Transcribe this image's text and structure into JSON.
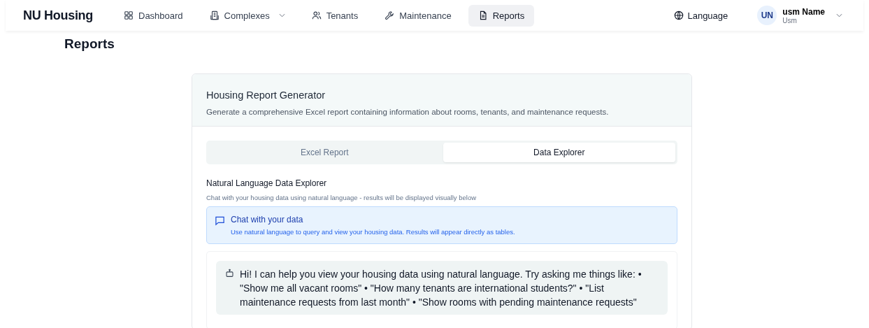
{
  "brand": "NU Housing",
  "nav": [
    {
      "label": "Dashboard",
      "dropdown": false,
      "selected": false
    },
    {
      "label": "Complexes",
      "dropdown": true,
      "selected": false
    },
    {
      "label": "Tenants",
      "dropdown": false,
      "selected": false
    },
    {
      "label": "Maintenance",
      "dropdown": false,
      "selected": false
    },
    {
      "label": "Reports",
      "dropdown": false,
      "selected": true
    }
  ],
  "language": "Language",
  "user": {
    "initials": "UN",
    "name": "usm Name",
    "role": "Usm"
  },
  "page_title": "Reports",
  "card": {
    "title": "Housing Report Generator",
    "description": "Generate a comprehensive Excel report containing information about rooms, tenants, and maintenance requests."
  },
  "tabs": [
    {
      "label": "Excel Report",
      "selected": false
    },
    {
      "label": "Data Explorer",
      "selected": true
    }
  ],
  "explorer": {
    "title": "Natural Language Data Explorer",
    "subtitle": "Chat with your housing data using natural language - results will be displayed visually below"
  },
  "info": {
    "title": "Chat with your data",
    "text": "Use natural language to query and view your housing data. Results will appear directly as tables."
  },
  "messages": [
    {
      "text": "Hi! I can help you view your housing data using natural language. Try asking me things like: • \"Show me all vacant rooms\" • \"How many tenants are international students?\" • \"List maintenance requests from last month\" • \"Show rooms with pending maintenance requests\""
    }
  ]
}
